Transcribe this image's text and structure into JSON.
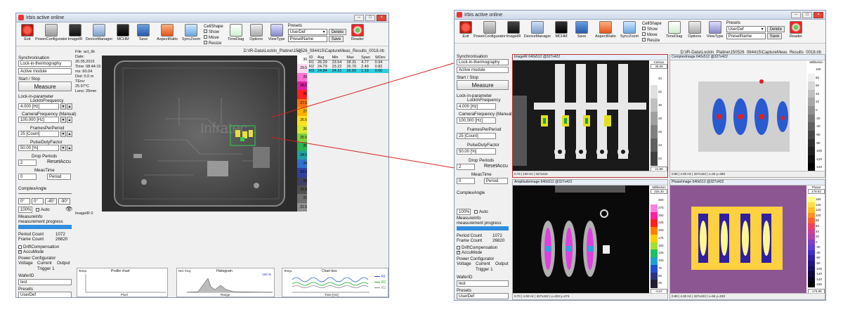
{
  "left_window": {
    "title": "Irbis active online",
    "toolbar": [
      {
        "label": "Exit",
        "icon": "exit-icon"
      },
      {
        "label": "PowerConfigurator",
        "icon": "power-configurator-icon"
      },
      {
        "label": "ImageIR",
        "icon": "camera-icon"
      },
      {
        "label": "DeviceManager",
        "icon": "device-manager-icon"
      },
      {
        "label": "MCHM",
        "icon": "mchm-icon"
      },
      {
        "label": "Save",
        "icon": "save-icon"
      },
      {
        "label": "AspectRatio",
        "icon": "aspect-ratio-icon"
      },
      {
        "label": "SyncZoom",
        "icon": "sync-zoom-icon"
      },
      {
        "label": "TimeDiag",
        "icon": "timediag-icon"
      },
      {
        "label": "Options",
        "icon": "options-icon"
      },
      {
        "label": "ViewType",
        "icon": "viewtype-icon"
      },
      {
        "label": "Reader",
        "icon": "reader-icon"
      }
    ],
    "cellshape": {
      "title": "CellShape",
      "show": "Show",
      "move": "Move",
      "resize": "Resize"
    },
    "presets": {
      "label": "Presets",
      "value": "UserDef",
      "delete": "Delete",
      "name_placeholder": "PresetName",
      "save": "Save"
    },
    "path": "D:\\IR-Data\\LockIn_Platine\\150526_084415\\CaptureMeas_Results_0018.irb",
    "synchronisation": "Synchronisation",
    "sync_mode": "Lock-in-thermography",
    "module": "Active module",
    "start_stop": "Start / Stop",
    "measure": "Measure",
    "lockin_param": "Lock-in-parameter",
    "lockin_freq_label": "LockInFrequency",
    "lockin_freq": "4.000 [Hz]",
    "camera_freq_label": "CameraFrequency (Manual)",
    "camera_freq": "100.000 [Hz]",
    "frames_label": "FramesPerPeriod",
    "frames": "25 [Count]",
    "pulse_label": "PulseDutyFactor",
    "pulse": "50.00 [%]",
    "drop_label": "Drop Periods",
    "drop_value": "2",
    "reset": "ResetAccu",
    "meastime_label": "MeasTime",
    "meastime_value": "0",
    "period": "Period",
    "complex_label": "ComplexAngle",
    "angles": [
      "0°",
      "0°",
      "-45°",
      "-90°"
    ],
    "zoom": "100%",
    "auto": "Auto",
    "measinfo": "MeasureInfo",
    "progress_label": "measurement progress",
    "progress": 1.0,
    "period_count_label": "Period Count",
    "period_count": "1072",
    "frame_count_label": "Frame Count",
    "frame_count": "26820",
    "drift": "DriftCompensation",
    "accu": "AccuMode",
    "power_cfg": "Power Configurator",
    "voltage": "Voltage",
    "current": "Current",
    "output": "Output",
    "trigger": "Trigger 1",
    "wafer": "WaferID",
    "wafer_value": "test",
    "presets2": "Presets",
    "presets2_value": "UserDef",
    "image_caption": "ImageIR 0",
    "info": [
      "File: act_lib",
      "Date:",
      "26.05.2015",
      "Time: 08:44:15",
      "ms: 60.04",
      "Dist: 0.0 m",
      "TEnv:",
      "25.97°C",
      "Lens: 25mm"
    ],
    "scale_unit": "°C",
    "scale": [
      "30",
      "29.5",
      "29",
      "28.5",
      "28",
      "27.5",
      "27",
      "26.5",
      "26",
      "25.5",
      "25",
      "24.5",
      "24",
      "23.5",
      "23",
      "22.5",
      "22",
      "21.5"
    ],
    "table_header": [
      "ID",
      "Avg",
      "Min",
      "Max",
      "Span",
      "StDev"
    ],
    "table_rows": [
      [
        "R1",
        "26.29",
        "23.54",
        "28.31",
        "4.77",
        "0.94"
      ],
      [
        "R2",
        "24.79",
        "23.22",
        "26.70",
        "2.49",
        "0.82"
      ],
      [
        "R3",
        "24.84",
        "24.31",
        "26.60",
        "1.19",
        "0.60"
      ]
    ],
    "logo_text": "Infratec",
    "profile_title": "Profile chart",
    "histogram_title": "Histogram",
    "chart_title": "Chart box",
    "temp_label": "Temp.",
    "rel_freq": "Rel. freq.",
    "pixel_label": "Pixel",
    "range_label": "Range",
    "time_label": "Time [ms]",
    "histo_pct": "100 %",
    "legend": [
      "R1",
      "R2",
      "R3"
    ]
  },
  "right_window": {
    "title": "Irbis active online",
    "path": "D:\\IR-Data\\LockIn_Platine\\150526_084415\\CaptureMeas_Results_0018.irb",
    "presets_value": "UserDef",
    "presetname": "PresetName",
    "panel1": {
      "title": "ImageIR 640x512 @327x422",
      "unit": "Celsius",
      "top": "36.99",
      "bottom": "21.88",
      "status": "0.74 | 100 Hz | 327x422",
      "scale": [
        "34",
        "32",
        "30",
        "28",
        "26",
        "24",
        "22"
      ]
    },
    "panel2": {
      "title": "ComplexImage 640x512 @327x422",
      "unit": "Millikelvin",
      "scale": [
        "100",
        "80",
        "60",
        "40",
        "20",
        "0",
        "-20",
        "-40",
        "-60",
        "-80",
        "-100",
        "-120",
        "-140"
      ],
      "status": "0.86 | 4.00 Hz | 327x422 | x=25 y=360"
    },
    "panel3": {
      "title": "AmplitudeImage 640x512 @327x422",
      "unit": "Millikelvin",
      "top": "325.30",
      "bottom": "-0.67",
      "scale": [
        "300",
        "275",
        "250",
        "225",
        "200",
        "175",
        "150",
        "125",
        "100",
        "75",
        "50",
        "25"
      ],
      "status": "0.70 | 4.00 Hz | 327x422 | x=223 y=274"
    },
    "panel4": {
      "title": "PhaseImage 640x512 @327x422",
      "unit": "Phase",
      "top": "178.93",
      "bottom": "-178.98",
      "scale": [
        "160",
        "140",
        "120",
        "100",
        "80",
        "60",
        "40",
        "20",
        "0",
        "-20",
        "-40",
        "-60",
        "-80",
        "-100",
        "-120",
        "-140",
        "-160"
      ],
      "status": "0.89 | 4.00 Hz | 327x422 | x=56 y=333"
    },
    "measinfo": "MeasureInfo",
    "progress_label": "measurement progress",
    "period_count": "1072",
    "frame_count": "26820"
  }
}
